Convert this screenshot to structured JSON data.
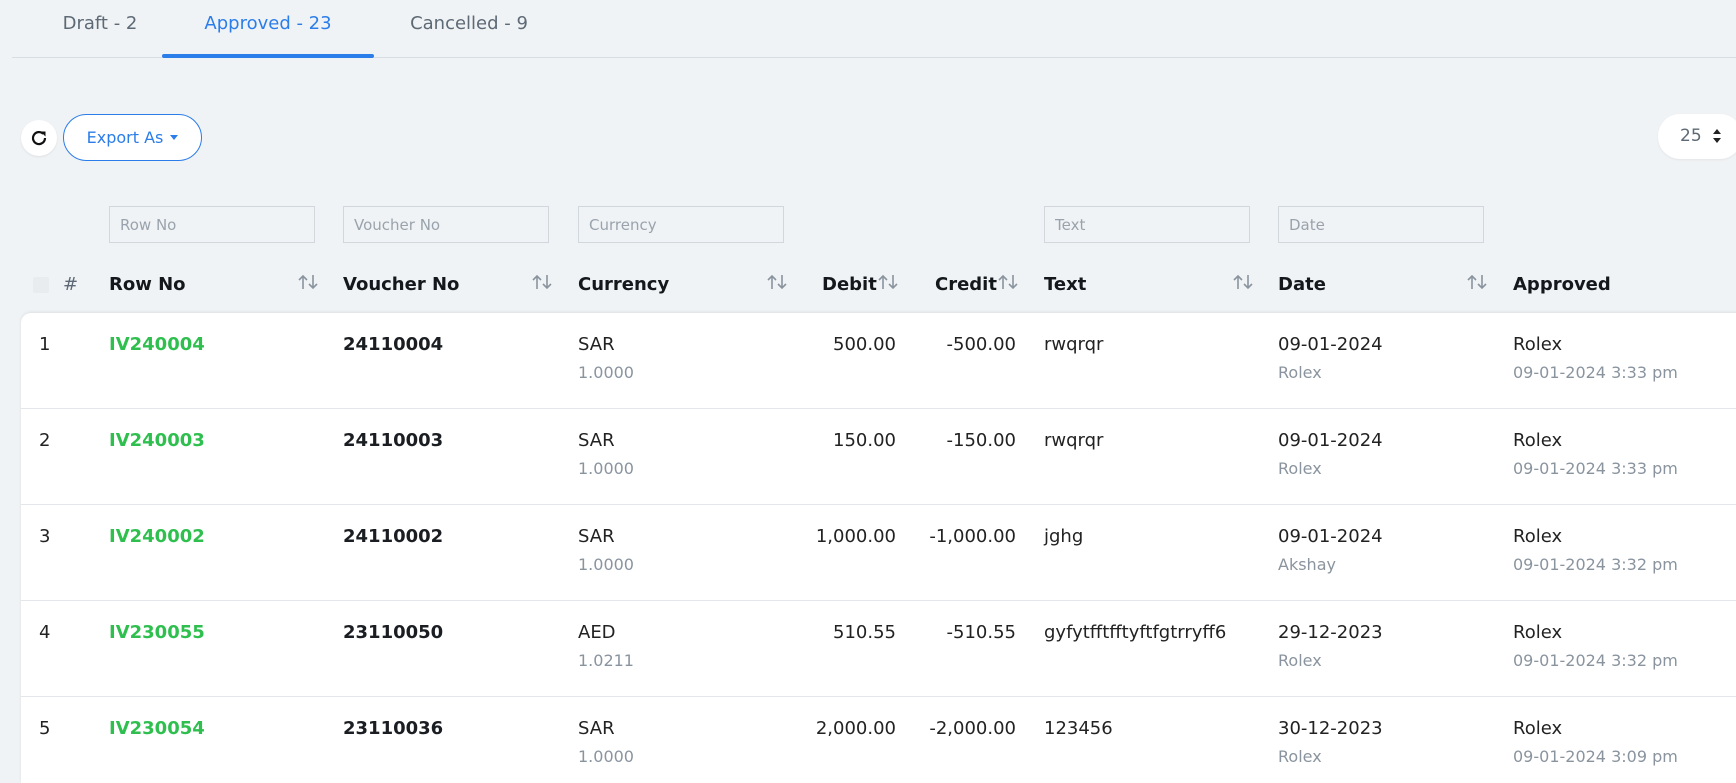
{
  "tabs": [
    {
      "label": "Draft - 2",
      "active": false
    },
    {
      "label": "Approved - 23",
      "active": true
    },
    {
      "label": "Cancelled - 9",
      "active": false
    }
  ],
  "toolbar": {
    "refresh_icon": "refresh-icon",
    "export_label": "Export As",
    "page_size": "25"
  },
  "filters": {
    "row_no": "Row No",
    "voucher_no": "Voucher No",
    "currency": "Currency",
    "text": "Text",
    "date": "Date"
  },
  "columns": {
    "index": "#",
    "row_no": "Row No",
    "voucher_no": "Voucher No",
    "currency": "Currency",
    "debit": "Debit",
    "credit": "Credit",
    "text": "Text",
    "date": "Date",
    "approved": "Approved"
  },
  "rows": [
    {
      "index": "1",
      "row_no": "IV240004",
      "voucher_no": "24110004",
      "currency": "SAR",
      "rate": "1.0000",
      "debit": "500.00",
      "credit": "-500.00",
      "text": "rwqrqr",
      "date": "09-01-2024",
      "created_by": "Rolex",
      "approved_by": "Rolex",
      "approved_at": "09-01-2024 3:33 pm"
    },
    {
      "index": "2",
      "row_no": "IV240003",
      "voucher_no": "24110003",
      "currency": "SAR",
      "rate": "1.0000",
      "debit": "150.00",
      "credit": "-150.00",
      "text": "rwqrqr",
      "date": "09-01-2024",
      "created_by": "Rolex",
      "approved_by": "Rolex",
      "approved_at": "09-01-2024 3:33 pm"
    },
    {
      "index": "3",
      "row_no": "IV240002",
      "voucher_no": "24110002",
      "currency": "SAR",
      "rate": "1.0000",
      "debit": "1,000.00",
      "credit": "-1,000.00",
      "text": "jghg",
      "date": "09-01-2024",
      "created_by": "Akshay",
      "approved_by": "Rolex",
      "approved_at": "09-01-2024 3:32 pm"
    },
    {
      "index": "4",
      "row_no": "IV230055",
      "voucher_no": "23110050",
      "currency": "AED",
      "rate": "1.0211",
      "debit": "510.55",
      "credit": "-510.55",
      "text": "gyfytfftfftyftfgtrryff6",
      "date": "29-12-2023",
      "created_by": "Rolex",
      "approved_by": "Rolex",
      "approved_at": "09-01-2024 3:32 pm"
    },
    {
      "index": "5",
      "row_no": "IV230054",
      "voucher_no": "23110036",
      "currency": "SAR",
      "rate": "1.0000",
      "debit": "2,000.00",
      "credit": "-2,000.00",
      "text": "123456",
      "date": "30-12-2023",
      "created_by": "Rolex",
      "approved_by": "Rolex",
      "approved_at": "09-01-2024 3:09 pm"
    }
  ],
  "colors": {
    "accent": "#2b7de9",
    "row_link": "#2fbf4f",
    "background": "#f0f3f5"
  }
}
